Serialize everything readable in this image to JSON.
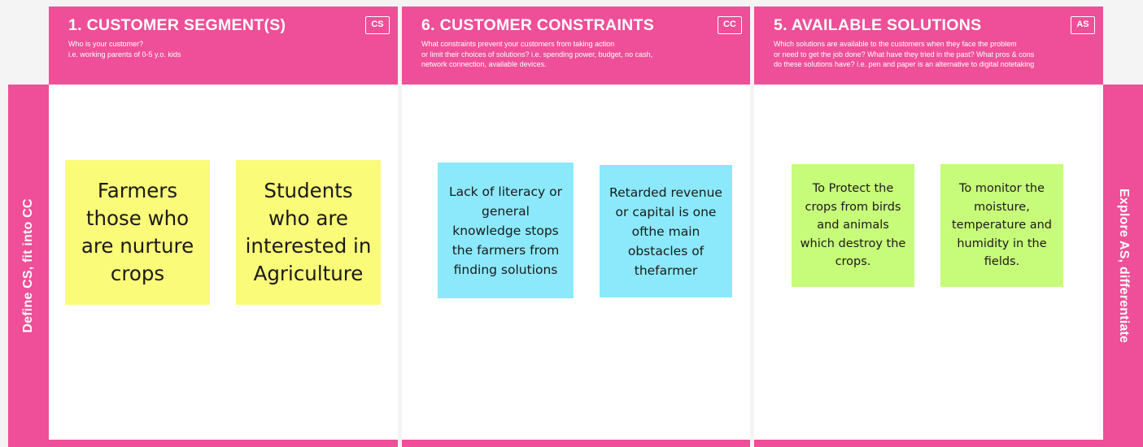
{
  "side": {
    "left_label": "Define CS, fit into CC",
    "right_label": "Explore AS, differentiate"
  },
  "sections": {
    "cs": {
      "title": "1. CUSTOMER SEGMENT(S)",
      "badge": "CS",
      "desc": [
        "Who is your customer?",
        "i.e. working parents of 0-5 y.o. kids"
      ],
      "notes": [
        "Farmers those who are nurture crops",
        "Students who are interested in Agriculture"
      ]
    },
    "cc": {
      "title": "6. CUSTOMER CONSTRAINTS",
      "badge": "CC",
      "desc": [
        "What constraints prevent your customers from taking action",
        "or limit their choices of solutions? i.e. spending power, budget, no cash,",
        "network connection, available devices."
      ],
      "notes": [
        "Lack of literacy or general knowledge stops the farmers from finding solutions",
        "Retarded revenue or capital is one ofthe main obstacles of thefarmer"
      ]
    },
    "as": {
      "title": "5. AVAILABLE SOLUTIONS",
      "badge": "AS",
      "desc": [
        "Which solutions are available to the customers when they face the problem",
        "or need to get the job done? What have they tried in the past? What pros & cons",
        "do these solutions have? i.e. pen and paper is an alternative to digital notetaking"
      ],
      "notes": [
        "To Protect the crops from birds and animals which destroy the crops.",
        "To monitor the moisture, temperature and humidity in the fields."
      ]
    }
  },
  "colors": {
    "pink": "#ef4f98",
    "note_yellow": "#fbfb7a",
    "note_blue": "#8be9fb",
    "note_green": "#c7fb7a"
  }
}
